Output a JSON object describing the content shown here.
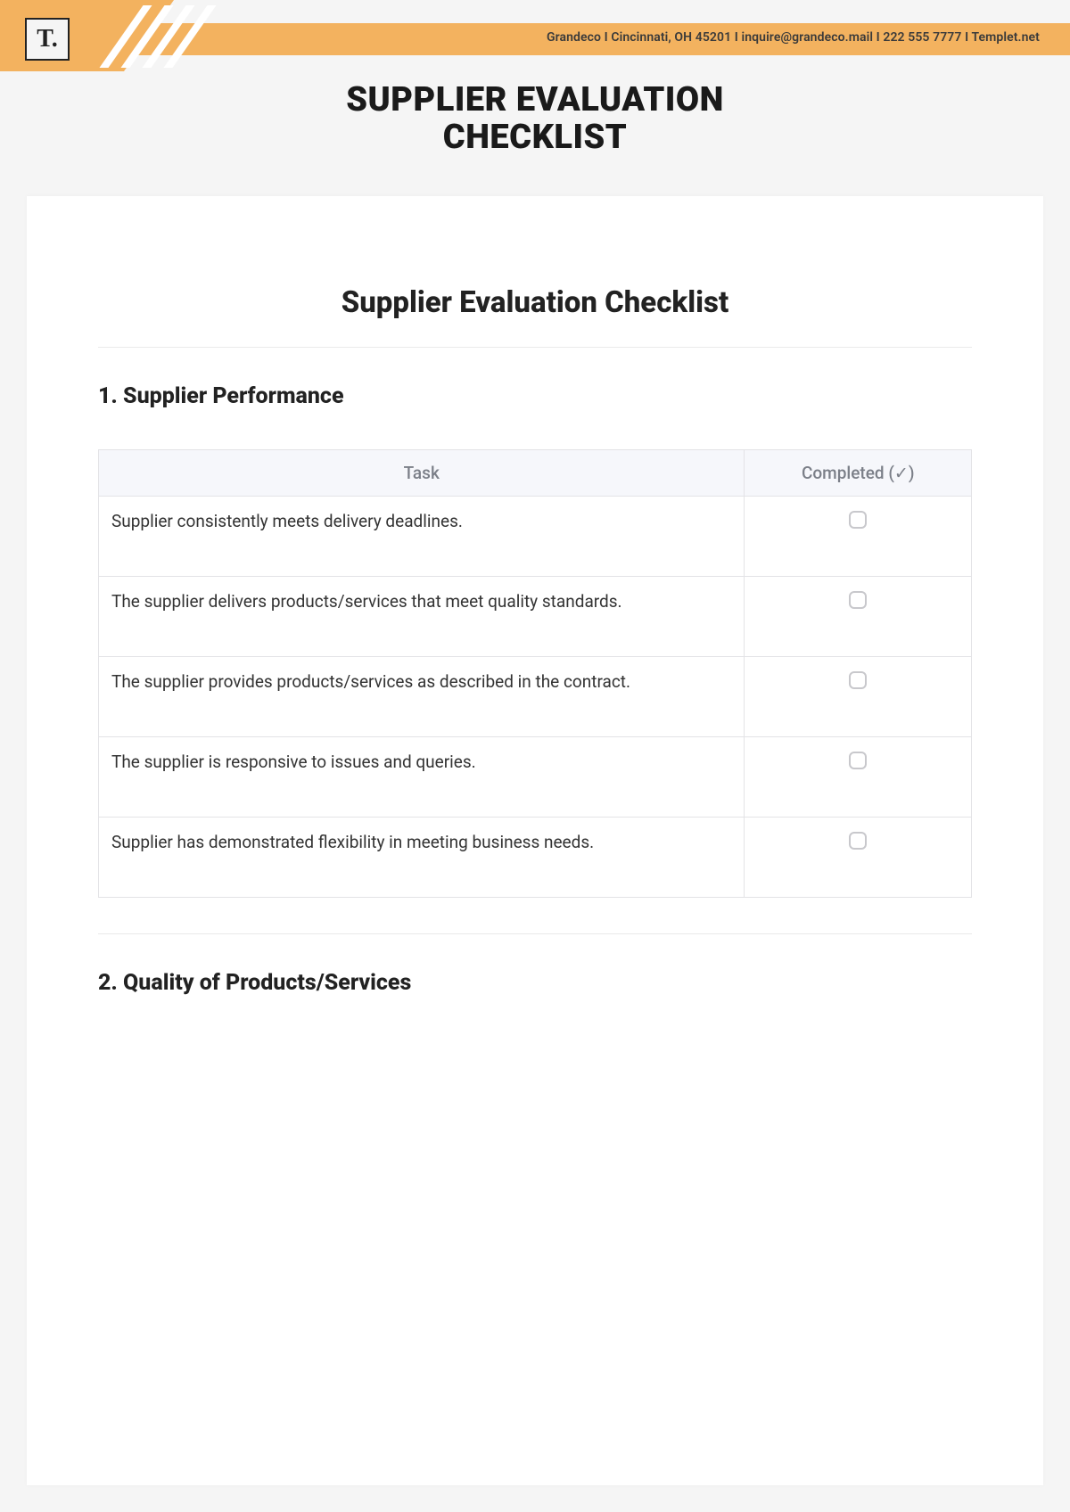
{
  "header": {
    "logo_text": "T.",
    "contact_line": "Grandeco I  Cincinnati, OH 45201  I  inquire@grandeco.mail I 222 555 7777 I Templet.net",
    "main_title_line1": "SUPPLIER EVALUATION",
    "main_title_line2": "CHECKLIST"
  },
  "document": {
    "title": "Supplier Evaluation Checklist"
  },
  "table_headers": {
    "task": "Task",
    "completed": "Completed (✓)"
  },
  "sections": [
    {
      "heading": "1. Supplier Performance",
      "rows": [
        {
          "task": "Supplier consistently meets delivery deadlines."
        },
        {
          "task": "The supplier delivers products/services that meet quality standards."
        },
        {
          "task": "The supplier provides products/services as described in the contract."
        },
        {
          "task": "The supplier is responsive to issues and queries."
        },
        {
          "task": "Supplier has demonstrated flexibility in meeting business needs."
        }
      ]
    },
    {
      "heading": "2. Quality of Products/Services",
      "rows": []
    }
  ]
}
